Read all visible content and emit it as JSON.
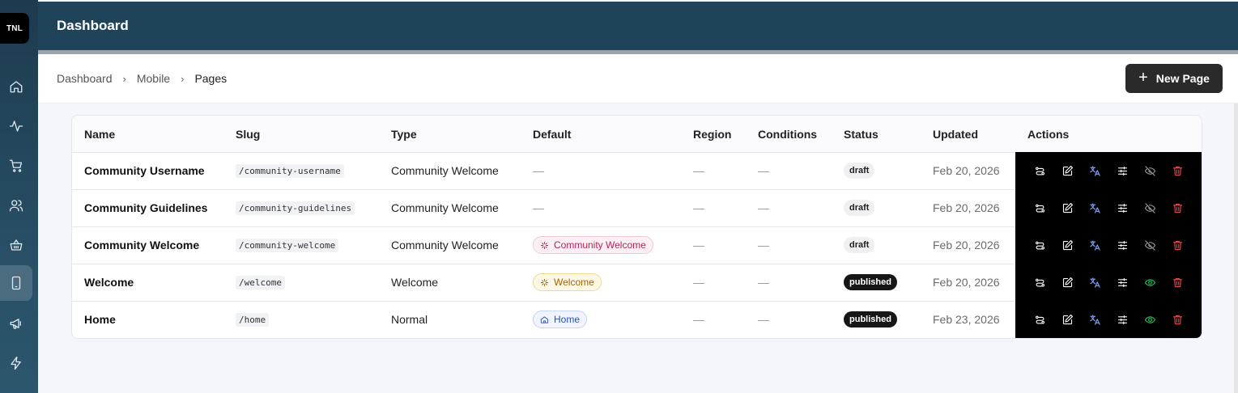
{
  "sidebar": {
    "logo": "TNL",
    "items": [
      {
        "name": "home-icon"
      },
      {
        "name": "activity-icon"
      },
      {
        "name": "cart-icon"
      },
      {
        "name": "users-icon"
      },
      {
        "name": "basket-icon"
      },
      {
        "name": "mobile-icon",
        "active": true
      },
      {
        "name": "megaphone-icon"
      },
      {
        "name": "lightning-icon"
      }
    ]
  },
  "header": {
    "title": "Dashboard"
  },
  "breadcrumb": {
    "items": [
      "Dashboard",
      "Mobile",
      "Pages"
    ]
  },
  "new_page_button": {
    "label": "New Page",
    "icon": "plus-icon"
  },
  "table": {
    "columns": [
      "Name",
      "Slug",
      "Type",
      "Default",
      "Region",
      "Conditions",
      "Status",
      "Updated",
      "Actions"
    ],
    "rows": [
      {
        "name": "Community Username",
        "slug": "/community-username",
        "type": "Community Welcome",
        "default": "—",
        "default_style": "none",
        "region": "—",
        "conditions": "—",
        "status": "draft",
        "updated": "Feb 20, 2026",
        "visibility": "hidden"
      },
      {
        "name": "Community Guidelines",
        "slug": "/community-guidelines",
        "type": "Community Welcome",
        "default": "—",
        "default_style": "none",
        "region": "—",
        "conditions": "—",
        "status": "draft",
        "updated": "Feb 20, 2026",
        "visibility": "hidden"
      },
      {
        "name": "Community Welcome",
        "slug": "/community-welcome",
        "type": "Community Welcome",
        "default": "Community Welcome",
        "default_style": "pink",
        "region": "—",
        "conditions": "—",
        "status": "draft",
        "updated": "Feb 20, 2026",
        "visibility": "hidden"
      },
      {
        "name": "Welcome",
        "slug": "/welcome",
        "type": "Welcome",
        "default": "Welcome",
        "default_style": "yellow",
        "region": "—",
        "conditions": "—",
        "status": "published",
        "updated": "Feb 20, 2026",
        "visibility": "visible"
      },
      {
        "name": "Home",
        "slug": "/home",
        "type": "Normal",
        "default": "Home",
        "default_style": "blue",
        "region": "—",
        "conditions": "—",
        "status": "published",
        "updated": "Feb 23, 2026",
        "visibility": "visible"
      }
    ],
    "row_actions": [
      "routes-icon",
      "edit-icon",
      "translate-icon",
      "settings-sliders-icon",
      "visibility-icon",
      "delete-icon"
    ]
  },
  "colors": {
    "header_bg": "#1f4459",
    "sidebar_bg": "#274e64",
    "actions_bg": "#000000",
    "delete": "#ef4444",
    "visible": "#22c55e",
    "translate": "#7ea6ff"
  }
}
